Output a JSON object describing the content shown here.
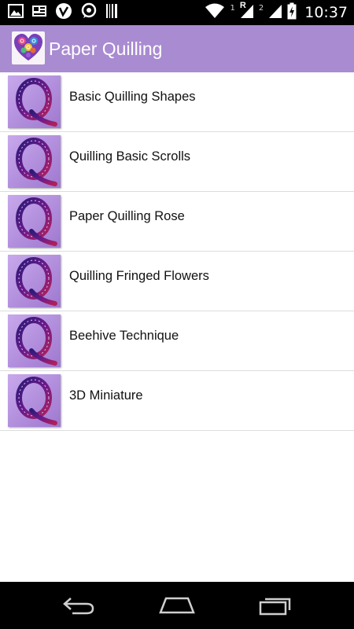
{
  "status_bar": {
    "time": "10:37",
    "sim1_label": "1",
    "sim1_network": "R",
    "sim2_label": "2",
    "left_icons": [
      "image-icon",
      "news-icon",
      "vine-icon",
      "whatsapp-icon",
      "barcode-icon"
    ],
    "right_icons": [
      "wifi-icon",
      "signal-1-icon",
      "signal-2-icon",
      "battery-icon"
    ]
  },
  "app_bar": {
    "title": "Paper Quilling",
    "icon": "quilled-heart-icon"
  },
  "list": {
    "items": [
      {
        "label": "Basic Quilling Shapes"
      },
      {
        "label": "Quilling Basic Scrolls"
      },
      {
        "label": "Paper Quilling Rose"
      },
      {
        "label": "Quilling Fringed Flowers"
      },
      {
        "label": "Beehive Technique"
      },
      {
        "label": "3D Miniature"
      }
    ]
  },
  "nav_bar": {
    "buttons": [
      "back-icon",
      "home-icon",
      "recents-icon"
    ]
  },
  "colors": {
    "accent": "#a98bd1",
    "status_bar": "#000000",
    "nav_bar": "#000000",
    "thumb_bg": "#b28fd9"
  }
}
